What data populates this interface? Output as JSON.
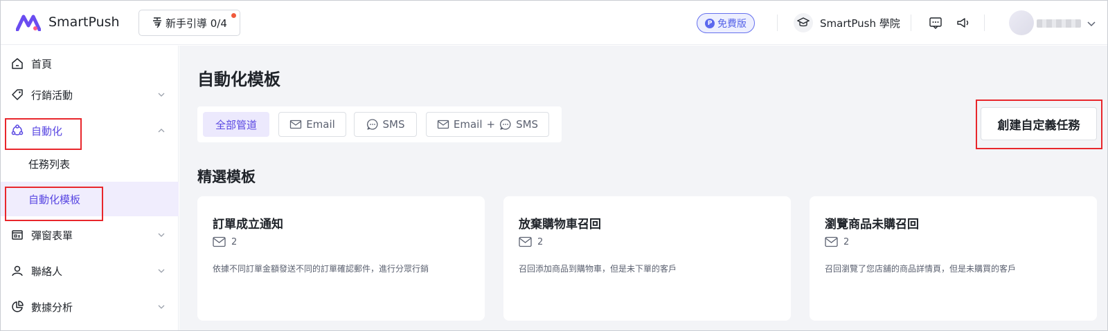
{
  "header": {
    "brand": "SmartPush",
    "guide_label": "新手引導 0/4",
    "plan_badge": "免費版",
    "academy_label": "SmartPush 學院",
    "icons": [
      "logo-icon",
      "guide-icon",
      "plan-icon",
      "academy-icon",
      "feedback-icon",
      "announcement-icon",
      "avatar",
      "chevron-down-icon"
    ]
  },
  "sidebar": {
    "items": [
      {
        "label": "首頁",
        "icon": "home-icon"
      },
      {
        "label": "行銷活動",
        "icon": "tag-icon"
      },
      {
        "label": "自動化",
        "icon": "automation-icon"
      },
      {
        "label": "任務列表"
      },
      {
        "label": "自動化模板"
      },
      {
        "label": "彈窗表單",
        "icon": "form-icon"
      },
      {
        "label": "聯絡人",
        "icon": "user-icon"
      },
      {
        "label": "數據分析",
        "icon": "chart-icon"
      }
    ]
  },
  "main": {
    "title": "自動化模板",
    "filters": [
      {
        "label": "全部管道"
      },
      {
        "label": "Email"
      },
      {
        "label": "SMS"
      },
      {
        "label_email": "Email",
        "plus": "+",
        "label_sms": "SMS"
      }
    ],
    "create_button": "創建自定義任務",
    "section_title": "精選模板",
    "cards": [
      {
        "title": "訂單成立通知",
        "count": "2",
        "desc": "依據不同訂單金額發送不同的訂單確認郵件，進行分眾行銷"
      },
      {
        "title": "放棄購物車召回",
        "count": "2",
        "desc": "召回添加商品到購物車，但是未下單的客戶"
      },
      {
        "title": "瀏覽商品未購召回",
        "count": "2",
        "desc": "召回瀏覽了您店舖的商品詳情頁，但是未購買的客戶"
      }
    ]
  },
  "colors": {
    "accent": "#5a48e2",
    "highlight_box": "#e8262b",
    "badge_blue": "#5563e8",
    "content_bg": "#f3f4f7"
  }
}
